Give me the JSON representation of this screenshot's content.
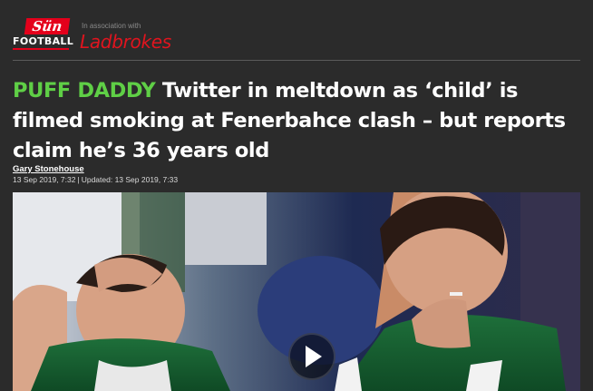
{
  "brand": {
    "sun_label": "Sün",
    "section_label": "FOOTBALL",
    "association_text": "In association with",
    "sponsor_label": "Ladbrokes"
  },
  "article": {
    "kicker": "PUFF DADDY",
    "headline": "Twitter in meltdown as ‘child’ is filmed smoking at Fenerbahce clash – but reports claim he’s 36 years old",
    "author": "Gary Stonehouse",
    "published": "13 Sep 2019, 7:32",
    "separator": "|",
    "updated": "Updated: 13 Sep 2019, 7:33"
  },
  "video": {
    "play_icon": "play-icon"
  },
  "colors": {
    "background": "#2b2b2b",
    "kicker": "#5fcf46",
    "brand_red": "#e4001b",
    "sponsor_red": "#e0141e"
  }
}
